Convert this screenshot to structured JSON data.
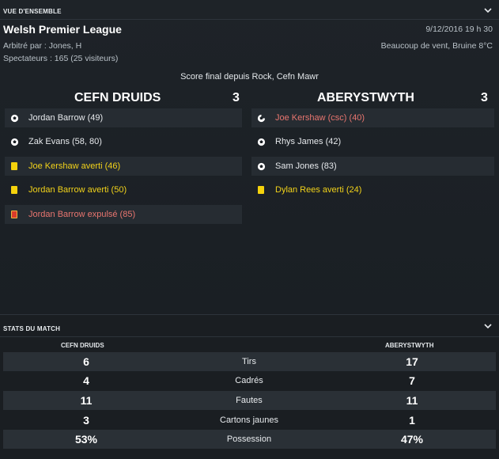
{
  "overview": {
    "section_title": "VUE D'ENSEMBLE",
    "competition": "Welsh Premier League",
    "referee": "Arbitré par : Jones, H",
    "spectators": "Spectateurs : 165 (25 visiteurs)",
    "datetime": "9/12/2016 19 h 30",
    "weather": "Beaucoup de vent, Bruine 8°C",
    "score_title": "Score final depuis Rock, Cefn Mawr"
  },
  "home": {
    "name": "CEFN DRUIDS",
    "goals": "3",
    "events": [
      {
        "type": "goal",
        "text": "Jordan Barrow (49)",
        "style": "normal"
      },
      {
        "type": "goal",
        "text": "Zak Evans (58, 80)",
        "style": "normal"
      },
      {
        "type": "yellow",
        "text": "Joe Kershaw averti (46)",
        "style": "yellow"
      },
      {
        "type": "yellow",
        "text": "Jordan Barrow averti (50)",
        "style": "yellow"
      },
      {
        "type": "red",
        "text": "Jordan Barrow expulsé (85)",
        "style": "red"
      }
    ]
  },
  "away": {
    "name": "ABERYSTWYTH",
    "goals": "3",
    "events": [
      {
        "type": "own-goal",
        "text": "Joe Kershaw (csc) (40)",
        "style": "red"
      },
      {
        "type": "goal",
        "text": "Rhys James (42)",
        "style": "normal"
      },
      {
        "type": "goal",
        "text": "Sam Jones (83)",
        "style": "normal"
      },
      {
        "type": "yellow",
        "text": "Dylan Rees averti (24)",
        "style": "yellow"
      }
    ]
  },
  "stats": {
    "section_title": "STATS DU MATCH",
    "home_label": "CEFN DRUIDS",
    "away_label": "ABERYSTWYTH",
    "rows": [
      {
        "label": "Tirs",
        "home": "6",
        "away": "17"
      },
      {
        "label": "Cadrés",
        "home": "4",
        "away": "7"
      },
      {
        "label": "Fautes",
        "home": "11",
        "away": "11"
      },
      {
        "label": "Cartons jaunes",
        "home": "3",
        "away": "1"
      },
      {
        "label": "Possession",
        "home": "53%",
        "away": "47%"
      }
    ]
  },
  "colors": {
    "background": "#1c2126",
    "yellow_text": "#f2d21a",
    "red_text": "#e8756f",
    "yellow_card": "#f5d20c",
    "red_card": "#d93b2b"
  }
}
